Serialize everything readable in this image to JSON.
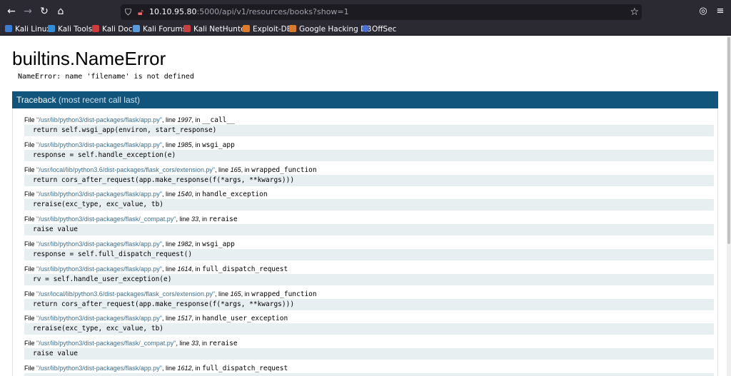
{
  "browser": {
    "url_host": "10.10.95.80",
    "url_path": ":5000/api/v1/resources/books?show=1",
    "bookmarks": [
      "Kali Linux",
      "Kali Tools",
      "Kali Docs",
      "Kali Forums",
      "Kali NetHunter",
      "Exploit-DB",
      "Google Hacking DB",
      "OffSec"
    ]
  },
  "error": {
    "title": "builtins.NameError",
    "message": "NameError: name 'filename' is not defined"
  },
  "traceback": {
    "title": "Traceback",
    "subtitle": "(most recent call last)",
    "frames": [
      {
        "file": "\"/usr/lib/python3/dist-packages/flask/app.py\"",
        "line": "1997",
        "func": "__call__",
        "code": "return self.wsgi_app(environ, start_response)"
      },
      {
        "file": "\"/usr/lib/python3/dist-packages/flask/app.py\"",
        "line": "1985",
        "func": "wsgi_app",
        "code": "response = self.handle_exception(e)"
      },
      {
        "file": "\"/usr/local/lib/python3.6/dist-packages/flask_cors/extension.py\"",
        "line": "165",
        "func": "wrapped_function",
        "code": "return cors_after_request(app.make_response(f(*args, **kwargs)))"
      },
      {
        "file": "\"/usr/lib/python3/dist-packages/flask/app.py\"",
        "line": "1540",
        "func": "handle_exception",
        "code": "reraise(exc_type, exc_value, tb)"
      },
      {
        "file": "\"/usr/lib/python3/dist-packages/flask/_compat.py\"",
        "line": "33",
        "func": "reraise",
        "code": "raise value"
      },
      {
        "file": "\"/usr/lib/python3/dist-packages/flask/app.py\"",
        "line": "1982",
        "func": "wsgi_app",
        "code": "response = self.full_dispatch_request()"
      },
      {
        "file": "\"/usr/lib/python3/dist-packages/flask/app.py\"",
        "line": "1614",
        "func": "full_dispatch_request",
        "code": "rv = self.handle_user_exception(e)"
      },
      {
        "file": "\"/usr/local/lib/python3.6/dist-packages/flask_cors/extension.py\"",
        "line": "165",
        "func": "wrapped_function",
        "code": "return cors_after_request(app.make_response(f(*args, **kwargs)))"
      },
      {
        "file": "\"/usr/lib/python3/dist-packages/flask/app.py\"",
        "line": "1517",
        "func": "handle_user_exception",
        "code": "reraise(exc_type, exc_value, tb)"
      },
      {
        "file": "\"/usr/lib/python3/dist-packages/flask/_compat.py\"",
        "line": "33",
        "func": "reraise",
        "code": "raise value"
      },
      {
        "file": "\"/usr/lib/python3/dist-packages/flask/app.py\"",
        "line": "1612",
        "func": "full_dispatch_request",
        "code": ""
      }
    ]
  }
}
